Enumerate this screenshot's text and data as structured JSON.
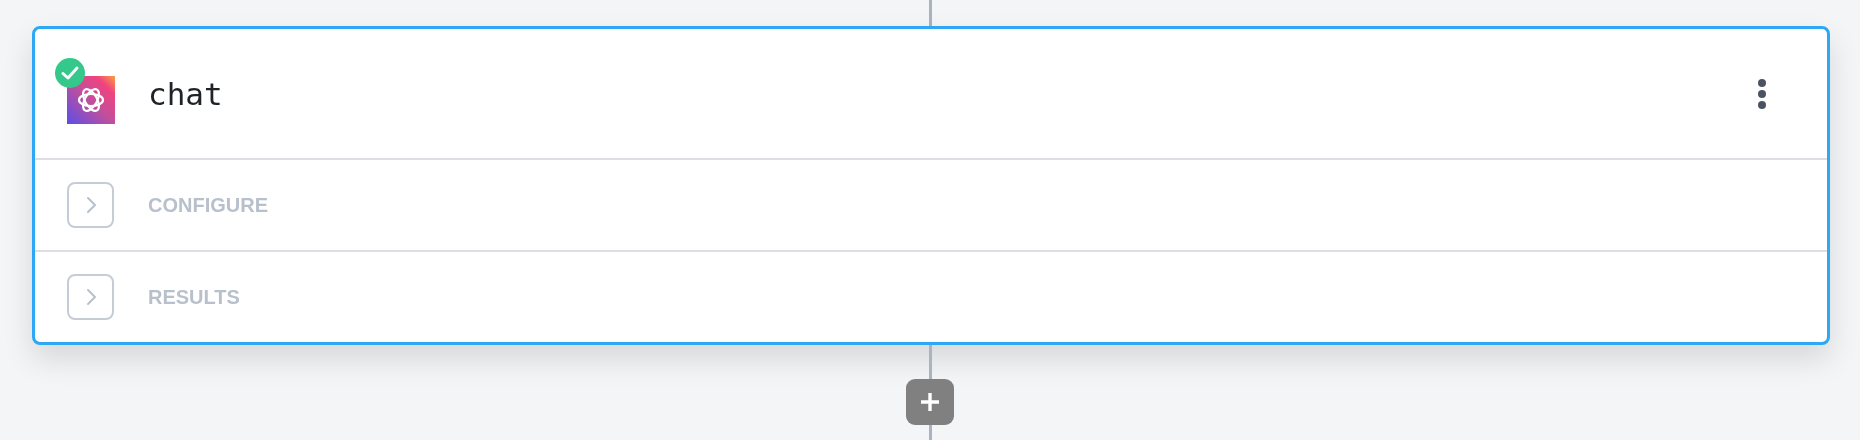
{
  "node": {
    "title": "chat",
    "succeeded": true,
    "selected": true
  },
  "sections": [
    {
      "label": "CONFIGURE",
      "expanded": false
    },
    {
      "label": "RESULTS",
      "expanded": false
    }
  ]
}
